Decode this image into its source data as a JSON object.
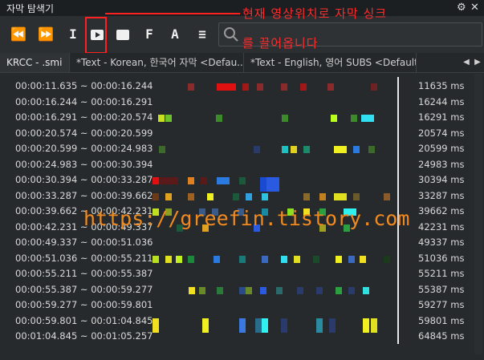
{
  "title": "자막 탐색기",
  "tabs": [
    "KRCC - .smi",
    "*Text - Korean, 한국어 자막 <Defau...",
    "*Text - English, 영어 SUBS <Default>"
  ],
  "rows": [
    {
      "time": "00:00:11.635 ~ 00:00:16.244",
      "ms": "11635 ms"
    },
    {
      "time": "00:00:16.244 ~ 00:00:16.291",
      "ms": "16244 ms"
    },
    {
      "time": "00:00:16.291 ~ 00:00:20.574",
      "ms": "16291 ms"
    },
    {
      "time": "00:00:20.574 ~ 00:00:20.599",
      "ms": "20574 ms"
    },
    {
      "time": "00:00:20.599 ~ 00:00:24.983",
      "ms": "20599 ms"
    },
    {
      "time": "00:00:24.983 ~ 00:00:30.394",
      "ms": "24983 ms"
    },
    {
      "time": "00:00:30.394 ~ 00:00:33.287",
      "ms": "30394 ms"
    },
    {
      "time": "00:00:33.287 ~ 00:00:39.662",
      "ms": "33287 ms"
    },
    {
      "time": "00:00:39.662 ~ 00:00:42.231",
      "ms": "39662 ms"
    },
    {
      "time": "00:00:42.231 ~ 00:00:49.337",
      "ms": "42231 ms"
    },
    {
      "time": "00:00:49.337 ~ 00:00:51.036",
      "ms": "49337 ms"
    },
    {
      "time": "00:00:51.036 ~ 00:00:55.211",
      "ms": "51036 ms"
    },
    {
      "time": "00:00:55.211 ~ 00:00:55.387",
      "ms": "55211 ms"
    },
    {
      "time": "00:00:55.387 ~ 00:00:59.277",
      "ms": "55387 ms"
    },
    {
      "time": "00:00:59.277 ~ 00:00:59.801",
      "ms": "59277 ms"
    },
    {
      "time": "00:00:59.801 ~ 00:01:04.845",
      "ms": "59801 ms"
    },
    {
      "time": "00:01:04.845 ~ 00:01:05.257",
      "ms": "64845 ms"
    }
  ],
  "annotation": {
    "line1": "현재 영상위치로 자막 싱크",
    "line2": "를 끌어옵니다"
  },
  "watermark": "https://greefin.tistory.com",
  "icons": [
    "rewind-icon",
    "fast-forward-icon",
    "text-cursor-icon",
    "play-icon",
    "stop-icon",
    "f-icon",
    "a-icon",
    "menu-icon",
    "search-icon",
    "gear-icon",
    "close-icon"
  ],
  "colors": {
    "accent_red": "#ff2b2b",
    "watermark": "#f08a20",
    "background": "#262a2c"
  }
}
